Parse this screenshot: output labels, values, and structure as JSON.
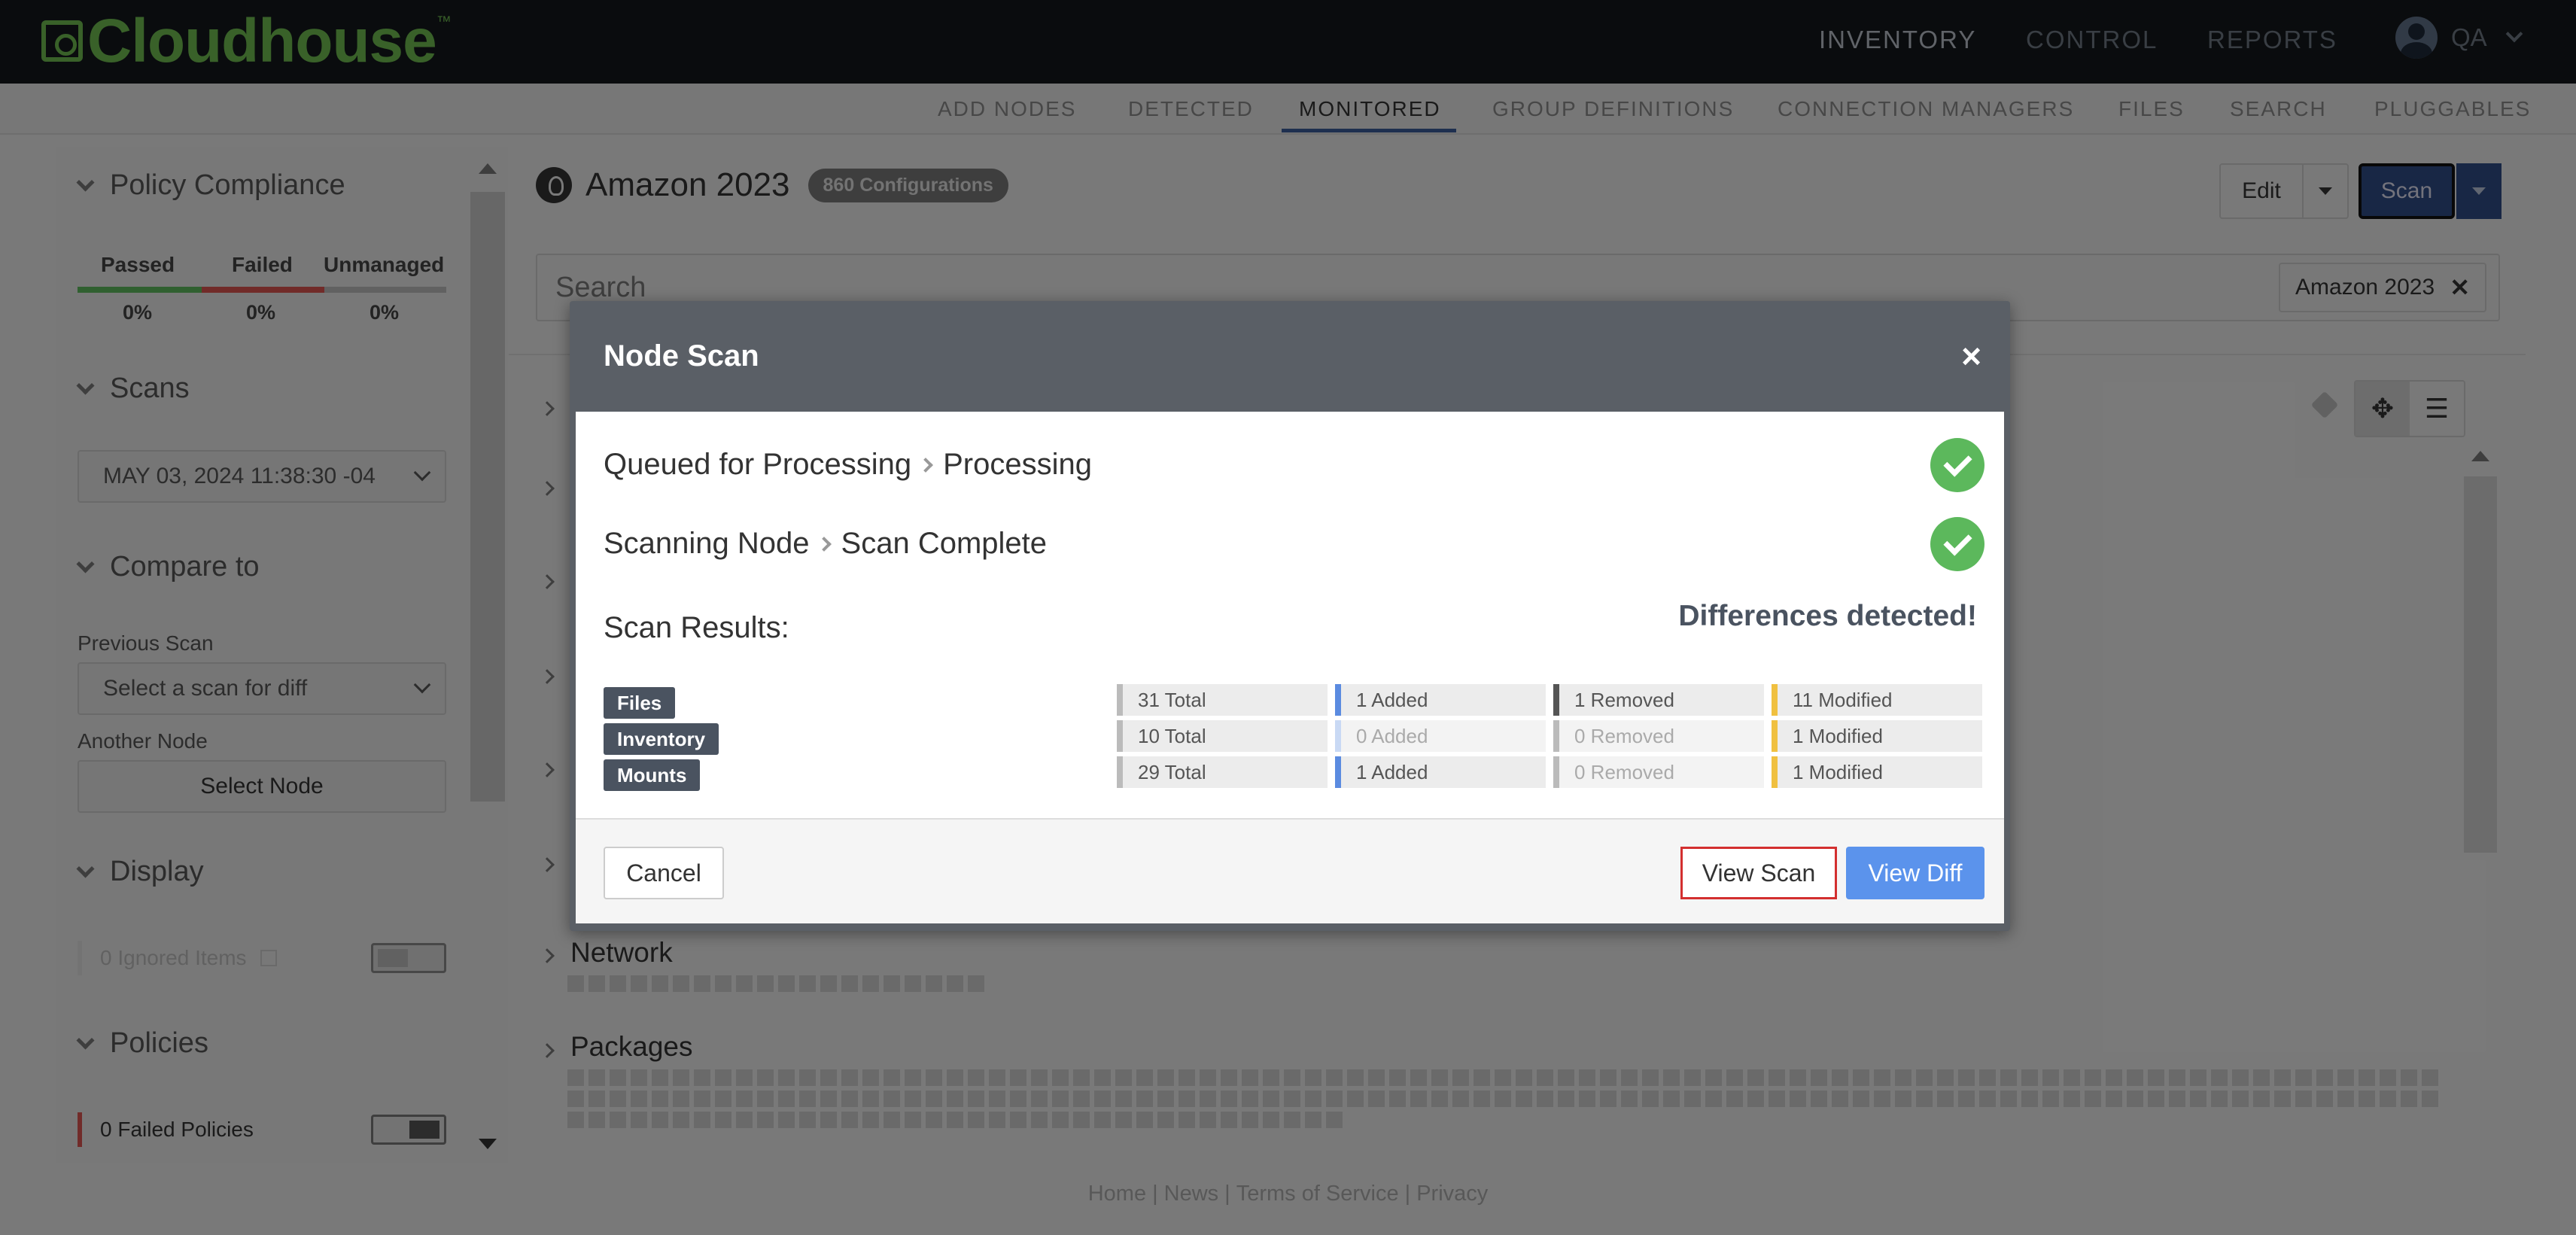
{
  "app": {
    "logo_text": "Cloudhouse",
    "logo_tm": "™",
    "nav": [
      "INVENTORY",
      "CONTROL",
      "REPORTS"
    ],
    "user": "QA"
  },
  "subnav": {
    "items": [
      "ADD NODES",
      "DETECTED",
      "MONITORED",
      "GROUP DEFINITIONS",
      "CONNECTION MANAGERS",
      "FILES",
      "SEARCH",
      "PLUGGABLES"
    ],
    "active": "MONITORED"
  },
  "sidebar": {
    "policy_compliance": {
      "title": "Policy Compliance",
      "passed_label": "Passed",
      "failed_label": "Failed",
      "unmanaged_label": "Unmanaged",
      "passed_value": "0%",
      "failed_value": "0%",
      "unmanaged_value": "0%",
      "colors": {
        "passed": "#5cb85c",
        "failed": "#d9534f",
        "unmanaged": "#bbbbbb"
      }
    },
    "scans": {
      "title": "Scans",
      "selected_scan": "MAY 03, 2024 11:38:30 -04"
    },
    "compare_to": {
      "title": "Compare to",
      "previous_scan_label": "Previous Scan",
      "previous_scan_value": "Select a scan for diff",
      "another_node_label": "Another Node",
      "select_node_button": "Select Node"
    },
    "display": {
      "title": "Display",
      "ignored_items": "0 Ignored Items"
    },
    "policies": {
      "title": "Policies",
      "failed_policies": "0 Failed Policies"
    }
  },
  "main": {
    "node_name": "Amazon 2023",
    "config_badge": "860 Configurations",
    "edit_button": "Edit",
    "scan_button": "Scan",
    "search_placeholder": "Search",
    "filter_chip": "Amazon 2023",
    "categories": [
      "Network",
      "Packages"
    ]
  },
  "modal": {
    "title": "Node Scan",
    "close": "×",
    "step1": {
      "from": "Queued for Processing",
      "to": "Processing"
    },
    "step2": {
      "from": "Scanning Node",
      "to": "Scan Complete"
    },
    "scan_results_label": "Scan Results:",
    "differences": "Differences detected!",
    "results": [
      {
        "name": "Files",
        "total": "31 Total",
        "added": "1 Added",
        "removed": "1 Removed",
        "modified": "11 Modified",
        "added_zero": false,
        "removed_zero": false
      },
      {
        "name": "Inventory",
        "total": "10 Total",
        "added": "0 Added",
        "removed": "0 Removed",
        "modified": "1 Modified",
        "added_zero": true,
        "removed_zero": true
      },
      {
        "name": "Mounts",
        "total": "29 Total",
        "added": "1 Added",
        "removed": "0 Removed",
        "modified": "1 Modified",
        "added_zero": false,
        "removed_zero": true
      }
    ],
    "cancel": "Cancel",
    "view_scan": "View Scan",
    "view_diff": "View Diff"
  },
  "footer": {
    "links": [
      "Home",
      "News",
      "Terms of Service",
      "Privacy"
    ],
    "separator": "|"
  }
}
